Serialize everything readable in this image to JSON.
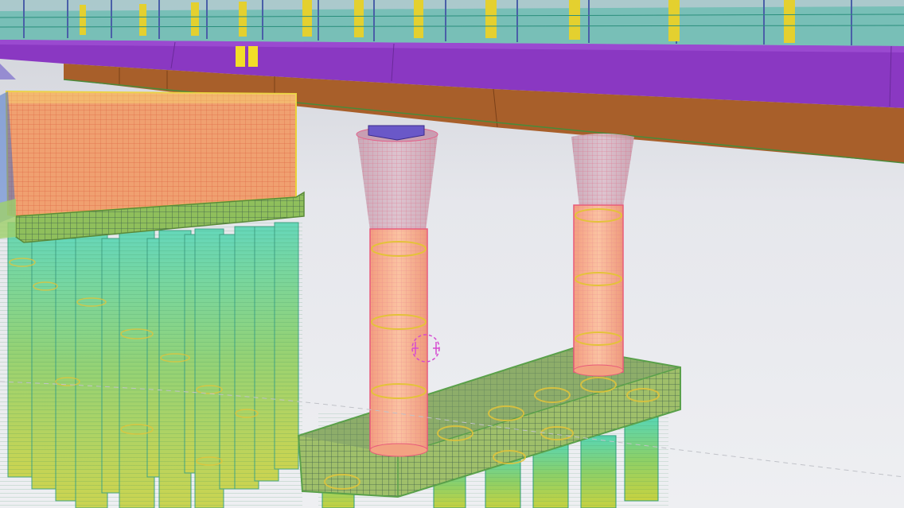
{
  "viewport": {
    "view_mode": "3D wireframe",
    "background_color": "#e6e7ec"
  },
  "model": {
    "objects": [
      {
        "type": "deck-railing",
        "color": "#2aa79a"
      },
      {
        "type": "deck-slab",
        "color": "#8a38c2"
      },
      {
        "type": "girder",
        "color": "#a85f2a"
      },
      {
        "type": "abutment-wall",
        "color": "#f0a070"
      },
      {
        "type": "pile-cap",
        "color": "#8fbf5c"
      },
      {
        "type": "pier-column",
        "color": "#f7b28a"
      },
      {
        "type": "bored-pile",
        "color": "#8fd06a"
      },
      {
        "type": "bearing",
        "color": "#6a58c8"
      },
      {
        "type": "reinforcement",
        "color": "#e8d23a"
      }
    ],
    "cursor_icon": "pick-cursor-icon",
    "cursor_color": "#d64bd0"
  }
}
